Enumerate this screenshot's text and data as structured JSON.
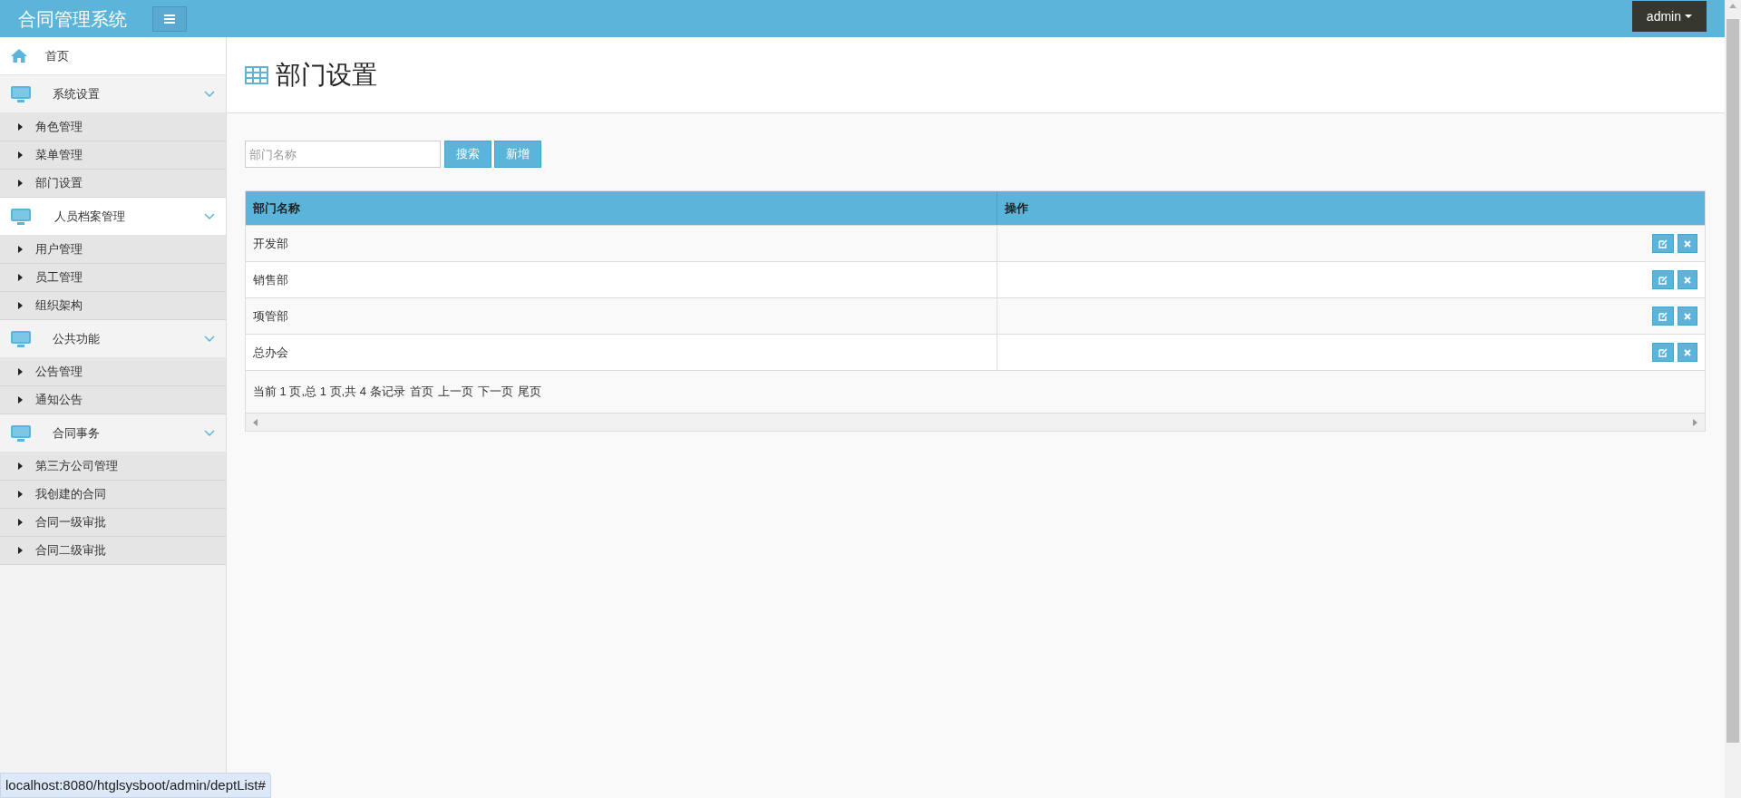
{
  "header": {
    "title": "合同管理系统",
    "user": "admin"
  },
  "sidebar": {
    "home": "首页",
    "groups": [
      {
        "label": "系统设置",
        "selected": false,
        "expanded": true,
        "items": [
          "角色管理",
          "菜单管理",
          "部门设置"
        ]
      },
      {
        "label": "人员档案管理",
        "selected": true,
        "expanded": true,
        "items": [
          "用户管理",
          "员工管理",
          "组织架构"
        ]
      },
      {
        "label": "公共功能",
        "selected": false,
        "expanded": true,
        "items": [
          "公告管理",
          "通知公告"
        ]
      },
      {
        "label": "合同事务",
        "selected": false,
        "expanded": true,
        "items": [
          "第三方公司管理",
          "我创建的合同",
          "合同一级审批",
          "合同二级审批"
        ]
      }
    ]
  },
  "page": {
    "title": "部门设置"
  },
  "search": {
    "placeholder": "部门名称",
    "buttons": [
      "搜索",
      "新增"
    ]
  },
  "table": {
    "columns": [
      "部门名称",
      "操作"
    ],
    "rows": [
      [
        "开发部"
      ],
      [
        "销售部"
      ],
      [
        "项管部"
      ],
      [
        "总办会"
      ]
    ],
    "pager": {
      "info": "当前 1 页,总 1 页,共 4 条记录",
      "links": [
        "首页",
        "上一页",
        "下一页",
        "尾页"
      ]
    }
  },
  "status_bar": "localhost:8080/htglsysboot/admin/deptList#"
}
